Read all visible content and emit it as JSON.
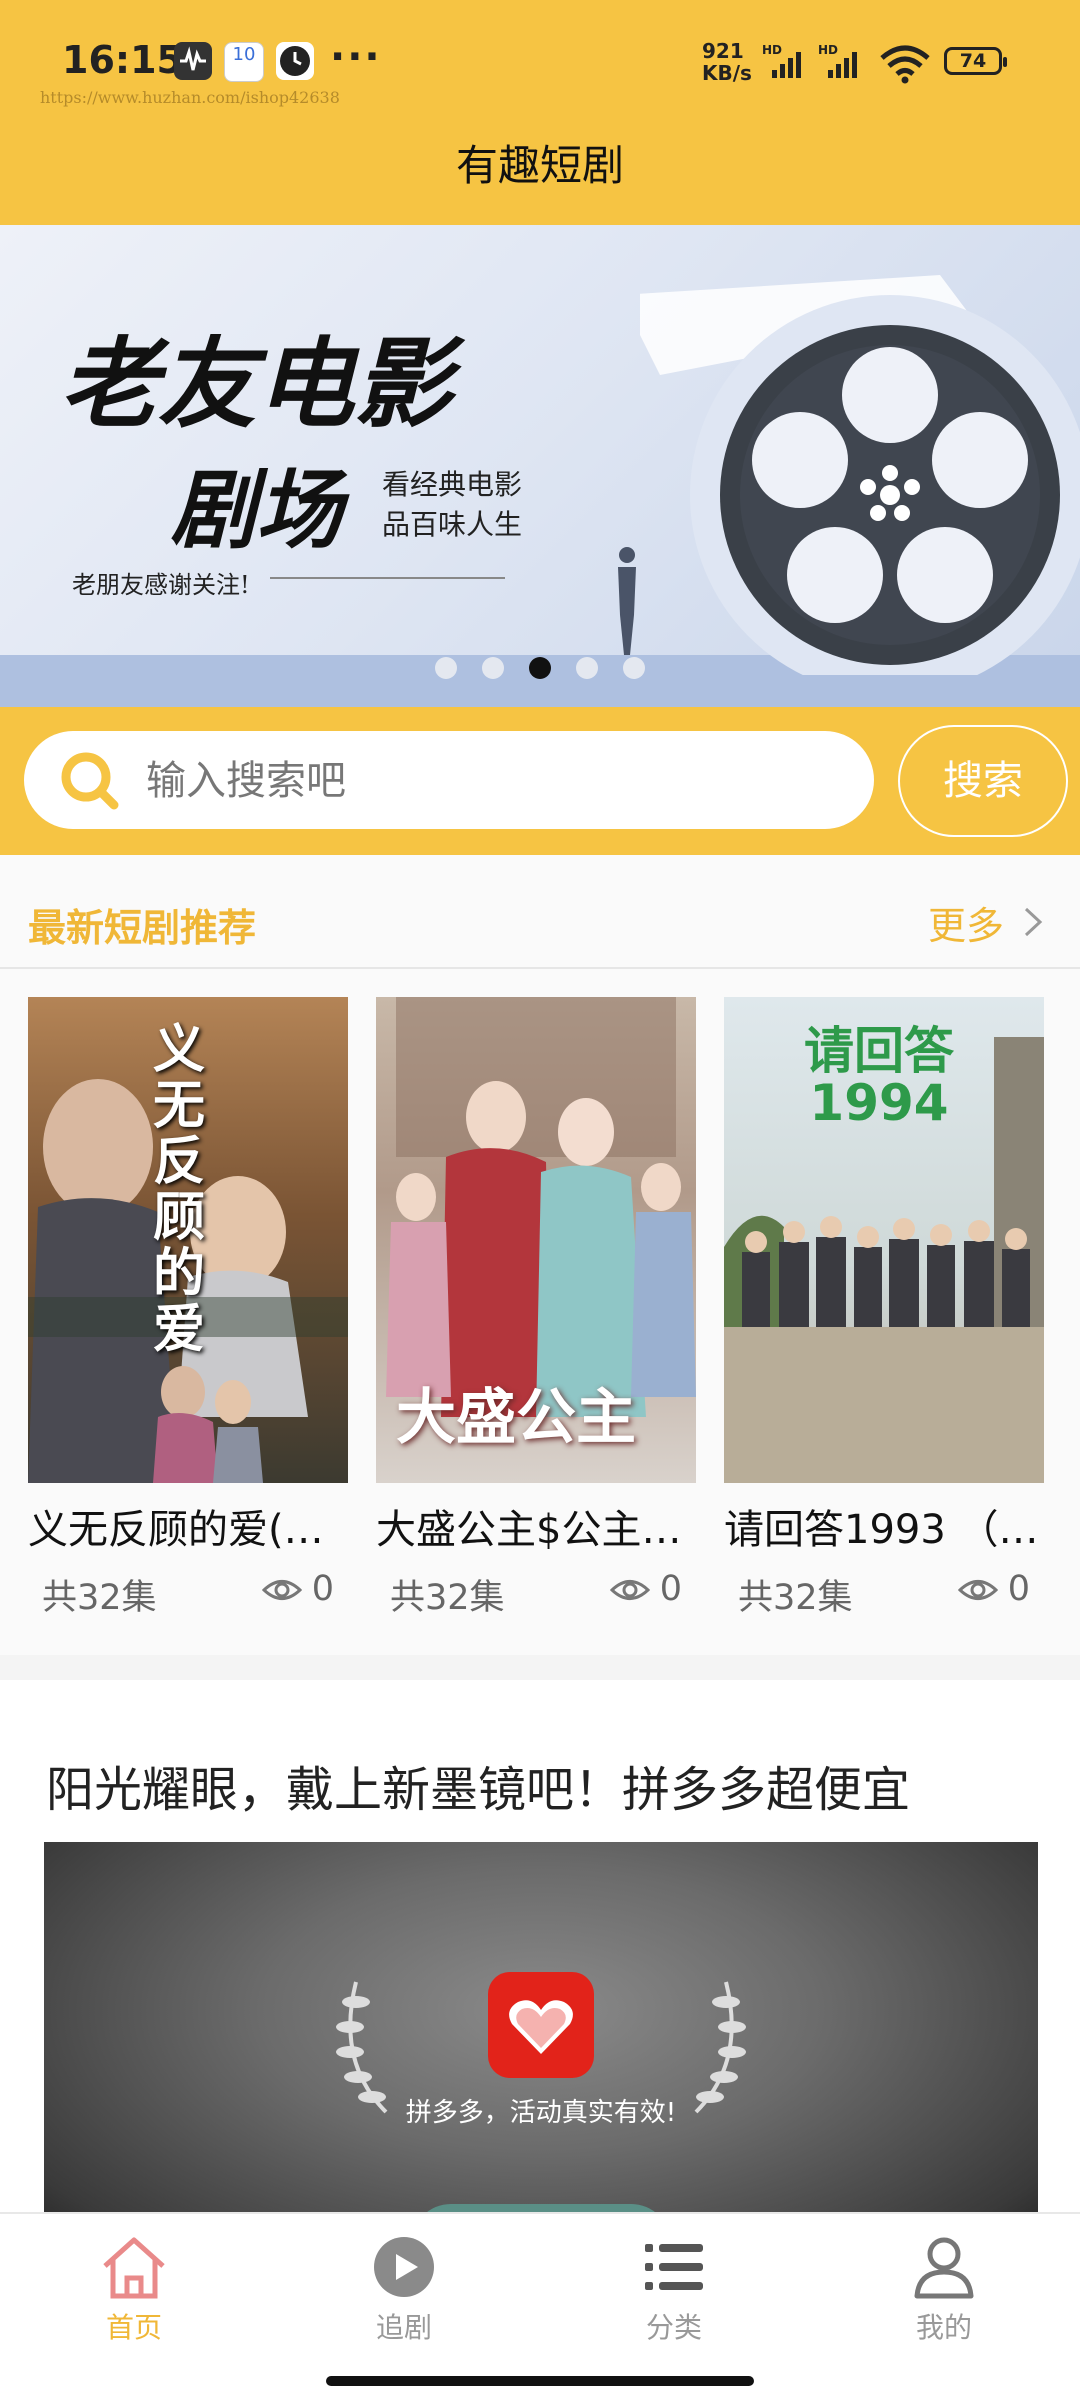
{
  "status_bar": {
    "time": "16:15",
    "notification_badge": "10",
    "overflow": "···",
    "watermark": "https://www.huzhan.com/ishop42638",
    "net_speed_value": "921",
    "net_speed_unit": "KB/s",
    "battery": "74"
  },
  "app": {
    "title": "有趣短剧"
  },
  "banner": {
    "title_line1": "老友电影",
    "title_line2": "剧场",
    "subtitle_line1": "看经典电影",
    "subtitle_line2": "品百味人生",
    "note": "老朋友感谢关注!",
    "slide_count": 5,
    "active_slide": 3
  },
  "search": {
    "placeholder": "输入搜索吧",
    "button_label": "搜索"
  },
  "recommend": {
    "title": "最新短剧推荐",
    "more_label": "更多",
    "items": [
      {
        "title": "义无反顾的爱(…",
        "poster_text": "义无反顾的爱",
        "episodes": "共32集",
        "views": "0"
      },
      {
        "title": "大盛公主$公主…",
        "poster_text": "大盛公主",
        "episodes": "共32集",
        "views": "0"
      },
      {
        "title": "请回答1993 （…",
        "poster_text": "请回答1994",
        "episodes": "共32集",
        "views": "0"
      }
    ]
  },
  "ad": {
    "title": "阳光耀眼，戴上新墨镜吧！拼多多超便宜",
    "caption": "拼多多，活动真实有效!"
  },
  "tabbar": {
    "items": [
      {
        "label": "首页",
        "icon": "home-icon",
        "active": true
      },
      {
        "label": "追剧",
        "icon": "play-icon",
        "active": false
      },
      {
        "label": "分类",
        "icon": "list-icon",
        "active": false
      },
      {
        "label": "我的",
        "icon": "user-icon",
        "active": false
      }
    ]
  },
  "colors": {
    "accent": "#f6c443",
    "accent_text": "#f0b737"
  }
}
